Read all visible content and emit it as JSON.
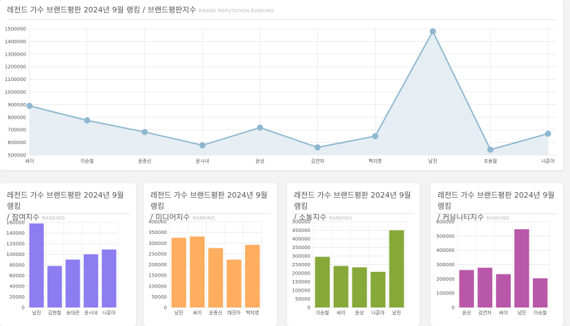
{
  "main": {
    "title": "레전드 가수 브랜드평판 2024년 9월 랭킹 / 브랜드평판지수",
    "subtitle": "BRAND REPUTATION RANKING"
  },
  "small": [
    {
      "title_line1": "레전드 가수 브랜드평판 2024년 9월 랭킹",
      "title_line2": "/ 참여지수",
      "subtitle": "RANKING"
    },
    {
      "title_line1": "레전드 가수 브랜드평판 2024년 9월 랭킹",
      "title_line2": "/ 미디어지수",
      "subtitle": "RANKING"
    },
    {
      "title_line1": "레전드 가수 브랜드평판 2024년 9월 랭킹",
      "title_line2": "/ 소통지수",
      "subtitle": "RANKING"
    },
    {
      "title_line1": "레전드 가수 브랜드평판 2024년 9월 랭킹",
      "title_line2": "/ 커뮤니티지수",
      "subtitle": "RANKING"
    }
  ],
  "chart_data": [
    {
      "type": "area",
      "title": "레전드 가수 브랜드평판 2024년 9월 랭킹 / 브랜드평판지수",
      "categories": [
        "싸이",
        "이승철",
        "윤종신",
        "윤시내",
        "윤상",
        "김연자",
        "백지영",
        "남진",
        "조용필",
        "나훈아"
      ],
      "values": [
        890000,
        775000,
        683000,
        578000,
        718000,
        561000,
        650000,
        1480000,
        543000,
        670000
      ],
      "ylim": [
        500000,
        1500000
      ],
      "yticks": [
        500000,
        600000,
        700000,
        800000,
        900000,
        1000000,
        1100000,
        1200000,
        1300000,
        1400000,
        1500000
      ],
      "grid": true,
      "color": "#8fb8d0",
      "fill": "#e6eef3"
    },
    {
      "type": "bar",
      "title": "레전드 가수 브랜드평판 2024년 9월 랭킹 / 참여지수",
      "categories": [
        "남진",
        "김현철",
        "송대관",
        "윤시내",
        "나훈아"
      ],
      "values": [
        158000,
        78000,
        90000,
        100000,
        109000
      ],
      "ylim": [
        0,
        160000
      ],
      "yticks": [
        0,
        20000,
        40000,
        60000,
        80000,
        100000,
        120000,
        140000,
        160000
      ],
      "grid": true,
      "color": "#8c7df0"
    },
    {
      "type": "bar",
      "title": "레전드 가수 브랜드평판 2024년 9월 랭킹 / 미디어지수",
      "categories": [
        "남진",
        "싸이",
        "윤종신",
        "태진아",
        "백지영"
      ],
      "values": [
        325000,
        331000,
        277000,
        223000,
        292000
      ],
      "ylim": [
        0,
        400000
      ],
      "yticks": [
        0,
        50000,
        100000,
        150000,
        200000,
        250000,
        300000,
        350000,
        400000
      ],
      "grid": true,
      "color": "#ffad5e"
    },
    {
      "type": "bar",
      "title": "레전드 가수 브랜드평판 2024년 9월 랭킹 / 소통지수",
      "categories": [
        "이승철",
        "싸이",
        "윤상",
        "나훈아",
        "남진"
      ],
      "values": [
        295000,
        242000,
        234000,
        208000,
        450000
      ],
      "ylim": [
        0,
        500000
      ],
      "yticks": [
        0,
        50000,
        100000,
        150000,
        200000,
        250000,
        300000,
        350000,
        400000,
        450000,
        500000
      ],
      "grid": true,
      "color": "#86a93a"
    },
    {
      "type": "bar",
      "title": "레전드 가수 브랜드평판 2024년 9월 랭킹 / 커뮤니티지수",
      "categories": [
        "윤상",
        "김연자",
        "싸이",
        "남진",
        "이승철"
      ],
      "values": [
        262000,
        278000,
        233000,
        547000,
        204000
      ],
      "ylim": [
        0,
        600000
      ],
      "yticks": [
        0,
        100000,
        200000,
        300000,
        400000,
        500000,
        600000
      ],
      "grid": true,
      "color": "#b957a8"
    }
  ]
}
